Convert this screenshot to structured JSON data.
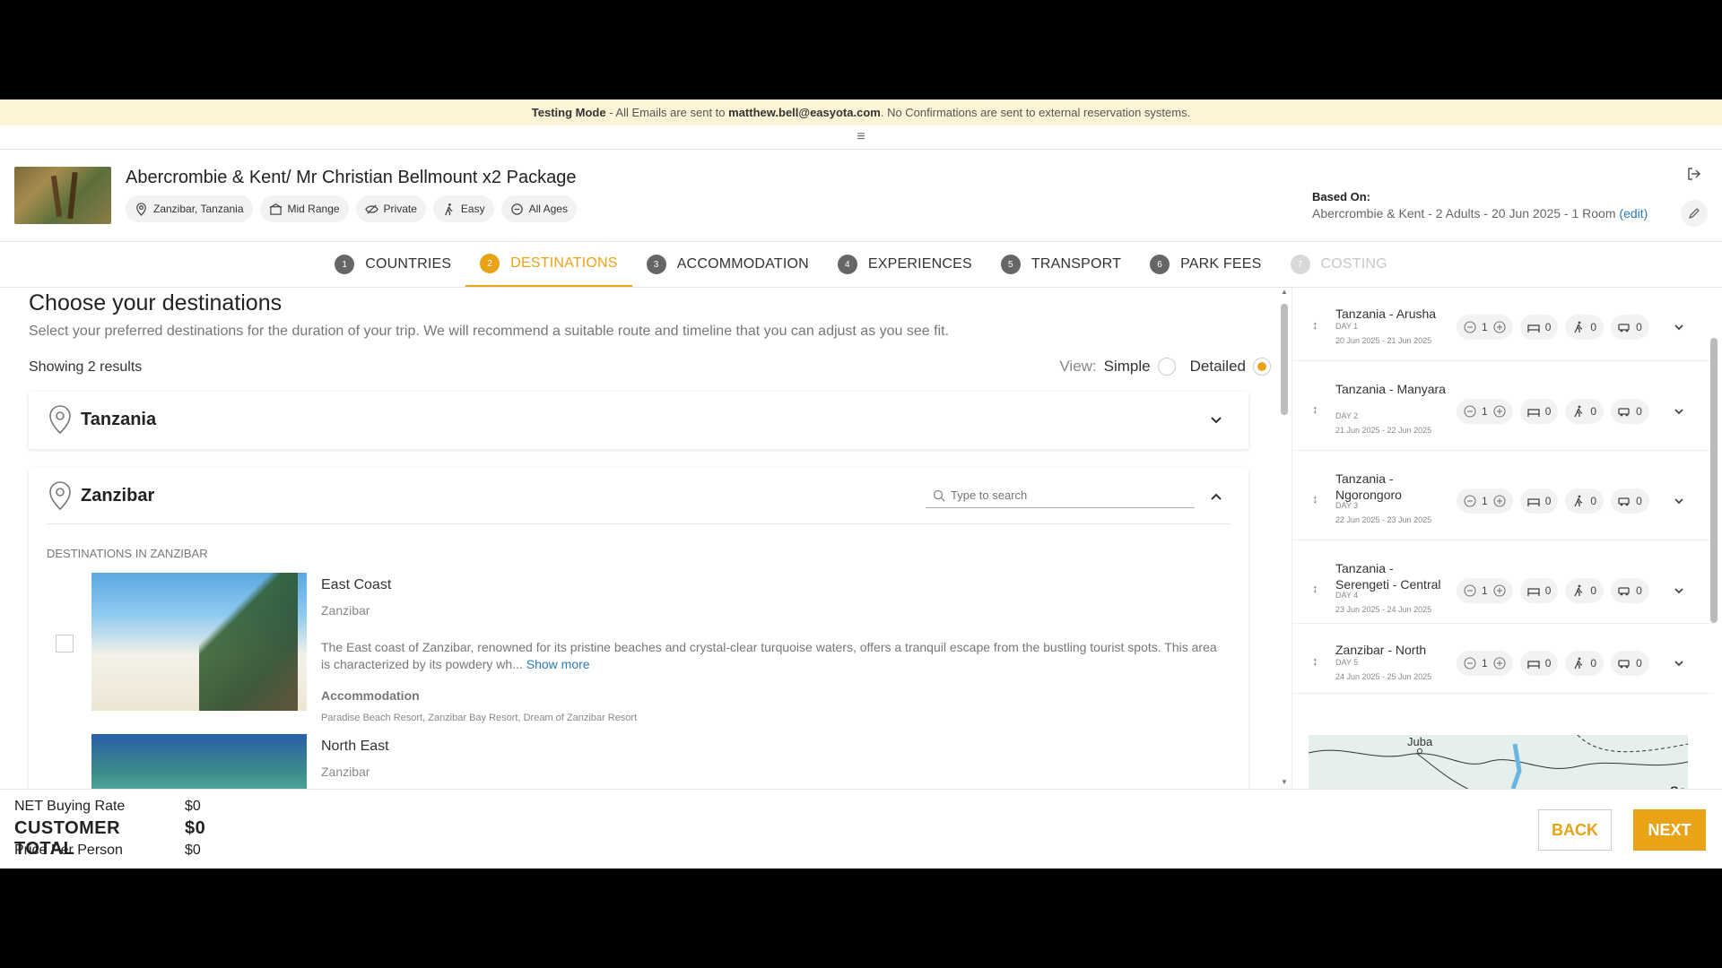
{
  "banner": {
    "mode": "Testing Mode",
    "text1": " - All Emails are sent to ",
    "email": "matthew.bell@easyota.com",
    "text2": ". No Confirmations are sent to external reservation systems."
  },
  "header": {
    "title": "Abercrombie & Kent/ Mr Christian Bellmount x2 Package",
    "chips": {
      "location": "Zanzibar, Tanzania",
      "tier": "Mid Range",
      "privacy": "Private",
      "activity": "Easy",
      "ages": "All Ages"
    },
    "based_on_label": "Based On:",
    "based_on_value": "Abercrombie & Kent - 2 Adults - 20 Jun 2025 - 1 Room",
    "edit_label": "(edit)"
  },
  "steps": [
    {
      "num": "1",
      "label": "COUNTRIES"
    },
    {
      "num": "2",
      "label": "DESTINATIONS"
    },
    {
      "num": "3",
      "label": "ACCOMMODATION"
    },
    {
      "num": "4",
      "label": "EXPERIENCES"
    },
    {
      "num": "5",
      "label": "TRANSPORT"
    },
    {
      "num": "6",
      "label": "PARK FEES"
    },
    {
      "num": "7",
      "label": "COSTING"
    }
  ],
  "main": {
    "title": "Choose your destinations",
    "subtitle": "Select your preferred destinations for the duration of your trip. We will recommend a suitable route and timeline that you can adjust as you see fit.",
    "results": "Showing 2 results",
    "view_label": "View:",
    "view_simple": "Simple",
    "view_detailed": "Detailed",
    "groups": [
      {
        "name": "Tanzania"
      },
      {
        "name": "Zanzibar",
        "search_placeholder": "Type to search",
        "dest_header": "DESTINATIONS IN ZANZIBAR",
        "destinations": [
          {
            "name": "East Coast",
            "region": "Zanzibar",
            "description": "The East coast of Zanzibar, renowned for its pristine beaches and crystal-clear turquoise waters, offers a tranquil escape from the bustling tourist spots. This area is characterized by its powdery wh...",
            "show_more": "Show more",
            "accommodation_label": "Accommodation",
            "accommodation": "Paradise Beach Resort, Zanzibar Bay Resort, Dream of Zanzibar Resort"
          },
          {
            "name": "North East",
            "region": "Zanzibar"
          }
        ]
      }
    ]
  },
  "itinerary": [
    {
      "title": "Tanzania - Arusha",
      "day": "DAY 1",
      "dates": "20 Jun 2025 - 21 Jun 2025",
      "nights": "1",
      "rooms": "0",
      "activities": "0",
      "vehicles": "0"
    },
    {
      "title": "Tanzania - Manyara",
      "day": "DAY 2",
      "dates": "21 Jun 2025 - 22 Jun 2025",
      "nights": "1",
      "rooms": "0",
      "activities": "0",
      "vehicles": "0"
    },
    {
      "title": "Tanzania - Ngorongoro",
      "day": "DAY 3",
      "dates": "22 Jun 2025 - 23 Jun 2025",
      "nights": "1",
      "rooms": "0",
      "activities": "0",
      "vehicles": "0"
    },
    {
      "title": "Tanzania - Serengeti - Central",
      "day": "DAY 4",
      "dates": "23 Jun 2025 - 24 Jun 2025",
      "nights": "1",
      "rooms": "0",
      "activities": "0",
      "vehicles": "0"
    },
    {
      "title": "Zanzibar - North",
      "day": "DAY 5",
      "dates": "24 Jun 2025 - 25 Jun 2025",
      "nights": "1",
      "rooms": "0",
      "activities": "0",
      "vehicles": "0"
    }
  ],
  "map": {
    "label1": "Juba",
    "label2": "So"
  },
  "footer": {
    "net_label": "NET Buying Rate",
    "net_value": "$0",
    "total_label": "CUSTOMER TOTAL",
    "total_value": "$0",
    "ppp_label": "Price Per Person",
    "ppp_value": "$0",
    "back": "BACK",
    "next": "NEXT"
  },
  "colors": {
    "accent": "#e8a317",
    "banner": "#fdf3d6",
    "link": "#2a7ab8"
  }
}
